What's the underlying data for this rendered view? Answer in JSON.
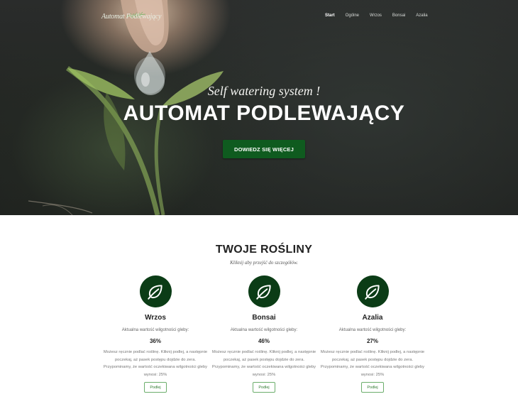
{
  "header": {
    "brand": "Automat Podlewający",
    "nav": [
      "Start",
      "Ogólne",
      "Wrzos",
      "Bonsai",
      "Azalia"
    ]
  },
  "hero": {
    "tagline": "Self watering system !",
    "headline": "AUTOMAT PODLEWAJĄCY",
    "cta_label": "DOWIEDZ SIĘ WIĘCEJ"
  },
  "plants_section": {
    "title": "TWOJE ROŚLINY",
    "subtitle": "Kliknij aby przejść do szczegółów.",
    "cards": [
      {
        "name": "Wrzos",
        "moisture_label": "Aktualna wartość wilgotności gleby:",
        "moisture_value": "36%",
        "description": "Możesz ręcznie podlać roślinę. Kliknij podlej, a następnie poczekaj, aż pasek postępu dojdzie do zera. Przypominamy, że wartość oczekiwana wilgotności gleby wynosi: 25%",
        "button_label": "Podlej",
        "icon": "leaf-icon"
      },
      {
        "name": "Bonsai",
        "moisture_label": "Aktualna wartość wilgotności gleby:",
        "moisture_value": "46%",
        "description": "Możesz ręcznie podlać roślinę. Kliknij podlej, a następnie poczekaj, aż pasek postępu dojdzie do zera. Przypominamy, że wartość oczekiwana wilgotności gleby wynosi: 25%",
        "button_label": "Podlej",
        "icon": "leaf-icon"
      },
      {
        "name": "Azalia",
        "moisture_label": "Aktualna wartość wilgotności gleby:",
        "moisture_value": "27%",
        "description": "Możesz ręcznie podlać roślinę. Kliknij podlej, a następnie poczekaj, aż pasek postępu dojdzie do zera. Przypominamy, że wartość oczekiwana wilgotności gleby wynosi: 25%",
        "button_label": "Podlej",
        "icon": "leaf-icon"
      }
    ]
  },
  "colors": {
    "accent": "#0f5b1f",
    "icon_bg": "#0b3c16",
    "button_border": "#6cae6c"
  }
}
